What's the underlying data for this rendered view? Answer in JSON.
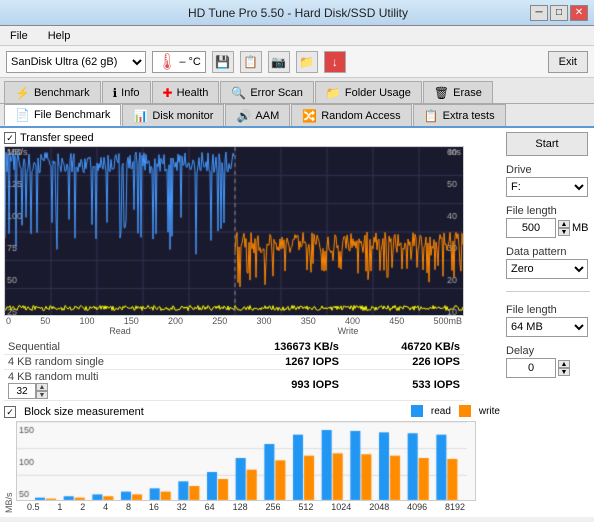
{
  "window": {
    "title": "HD Tune Pro 5.50 - Hard Disk/SSD Utility",
    "controls": [
      "─",
      "□",
      "✕"
    ]
  },
  "menu": {
    "items": [
      "File",
      "Help"
    ]
  },
  "toolbar": {
    "drive": "SanDisk Ultra (62 gB)",
    "temp": "– °C",
    "exit_label": "Exit"
  },
  "tabs_row1": [
    {
      "label": "Benchmark",
      "icon": "⚡",
      "active": false
    },
    {
      "label": "Info",
      "icon": "ℹ",
      "active": false
    },
    {
      "label": "Health",
      "icon": "➕",
      "active": false
    },
    {
      "label": "Error Scan",
      "icon": "🔍",
      "active": false
    },
    {
      "label": "Folder Usage",
      "icon": "📁",
      "active": false
    },
    {
      "label": "Erase",
      "icon": "🗑",
      "active": false
    }
  ],
  "tabs_row2": [
    {
      "label": "File Benchmark",
      "icon": "📄",
      "active": true
    },
    {
      "label": "Disk monitor",
      "icon": "📊",
      "active": false
    },
    {
      "label": "AAM",
      "icon": "🔊",
      "active": false
    },
    {
      "label": "Random Access",
      "icon": "🔀",
      "active": false
    },
    {
      "label": "Extra tests",
      "icon": "📋",
      "active": false
    }
  ],
  "benchmark": {
    "transfer_speed_label": "Transfer speed",
    "chart": {
      "y_axis_left": [
        "150",
        "125",
        "100",
        "75",
        "50",
        "25"
      ],
      "y_axis_right": [
        "60",
        "50",
        "40",
        "30",
        "20",
        "10"
      ],
      "x_axis": [
        "0",
        "50",
        "100",
        "150",
        "200",
        "250",
        "300",
        "350",
        "400",
        "450",
        "500mB"
      ],
      "x_label_left": "Read",
      "x_label_right": "Write",
      "y_unit_left": "MB/s",
      "y_unit_right": "ms"
    }
  },
  "stats": {
    "col_headers": [
      "",
      "Read",
      "Write"
    ],
    "rows": [
      {
        "label": "Sequential",
        "read": "136673 KB/s",
        "write": "46720 KB/s"
      },
      {
        "label": "4 KB random single",
        "read": "1267 IOPS",
        "write": "226 IOPS"
      },
      {
        "label": "4 KB random multi",
        "spin_val": "32",
        "read": "993 IOPS",
        "write": "533 IOPS"
      }
    ]
  },
  "block_size": {
    "label": "Block size measurement",
    "legend": {
      "read": "read",
      "write": "write"
    },
    "y_unit": "MB/s",
    "y_max": 150,
    "x_labels": [
      "0.5",
      "1",
      "2",
      "4",
      "8",
      "16",
      "32",
      "64",
      "128",
      "256",
      "512",
      "1024",
      "2048",
      "4096",
      "8192"
    ]
  },
  "right_panel_top": {
    "start_label": "Start",
    "drive_label": "Drive",
    "drive_value": "F:",
    "file_length_label": "File length",
    "file_length_value": "500",
    "file_length_unit": "MB",
    "data_pattern_label": "Data pattern",
    "data_pattern_value": "Zero"
  },
  "right_panel_bottom": {
    "file_length_label": "File length",
    "file_length_value": "64 MB",
    "delay_label": "Delay",
    "delay_value": "0"
  },
  "colors": {
    "read_line": "#00aaff",
    "write_line": "#ff6600",
    "ms_line": "#ffff00",
    "bar_read": "#2196f3",
    "bar_write": "#ff8c00",
    "chart_bg": "#1a1a2e",
    "accent": "#5b9bd5"
  }
}
